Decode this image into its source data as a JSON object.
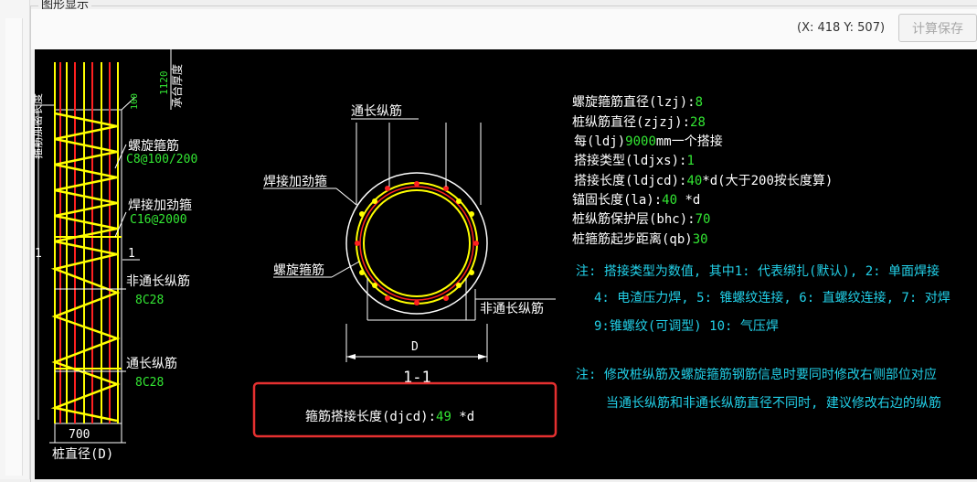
{
  "window": {
    "group_title": "图形显示"
  },
  "toolbar": {
    "coordinates": "(X: 418 Y: 507)",
    "save_label": "计算保存"
  },
  "colors": {
    "canvas_bg": "#000000",
    "rebar_yellow": "#ffff00",
    "rebar_red": "#ff2020",
    "value_green": "#33e633",
    "note_cyan": "#22d0e8",
    "highlight_red": "#e53030"
  },
  "elevation": {
    "cap_thickness_label": "承台厚度",
    "cap_thickness_value": "1120",
    "dim_100": "100",
    "dense_length_label": "箍筋加密长度",
    "spiral_label": "螺旋箍筋",
    "spiral_value": "C8@100/200",
    "weld_label": "焊接加劲箍",
    "weld_value": "C16@2000",
    "section_mark_left": "1",
    "section_mark_right": "1",
    "non_through_label": "非通长纵筋",
    "non_through_value": "8C28",
    "through_label": "通长纵筋",
    "through_value": "8C28",
    "width_value": "700",
    "pile_diameter_label": "桩直径(D)"
  },
  "section": {
    "through_label": "通长纵筋",
    "weld_label": "焊接加劲箍",
    "spiral_label": "螺旋箍筋",
    "non_through_label": "非通长纵筋",
    "diameter_label": "D",
    "section_title": "1-1"
  },
  "params": [
    {
      "label": "螺旋箍筋直径(lzj):",
      "value": "8",
      "suffix": ""
    },
    {
      "label": "桩纵筋直径(zjzj):",
      "value": "28",
      "suffix": ""
    },
    {
      "label": "每(ldj)",
      "value": "9000",
      "suffix": "mm一个搭接"
    },
    {
      "label": "搭接类型(ldjxs):",
      "value": "1",
      "suffix": ""
    },
    {
      "label": "搭接长度(ldjcd):",
      "value": "40",
      "suffix": "*d(大于200按长度算)"
    },
    {
      "label": "锚固长度(la):",
      "value": "40",
      "suffix": " *d"
    },
    {
      "label": "桩纵筋保护层(bhc):",
      "value": "70",
      "suffix": ""
    },
    {
      "label": "桩箍筋起步距离(qb)",
      "value": "30",
      "suffix": ""
    }
  ],
  "notes": {
    "note1_line1": "注: 搭接类型为数值, 其中1: 代表绑扎(默认), 2: 单面焊接",
    "note1_line2": "4: 电渣压力焊, 5: 锥螺纹连接, 6: 直螺纹连接, 7: 对焊",
    "note1_line3": "9:锥螺纹(可调型) 10: 气压焊",
    "note2_line1": "注: 修改桩纵筋及螺旋箍筋钢筋信息时要同时修改右侧部位对应",
    "note2_line2": "当通长纵筋和非通长纵筋直径不同时, 建议修改右边的纵筋"
  },
  "stirrup_lap": {
    "label": "箍筋搭接长度(djcd):",
    "value": "49",
    "suffix": " *d"
  }
}
